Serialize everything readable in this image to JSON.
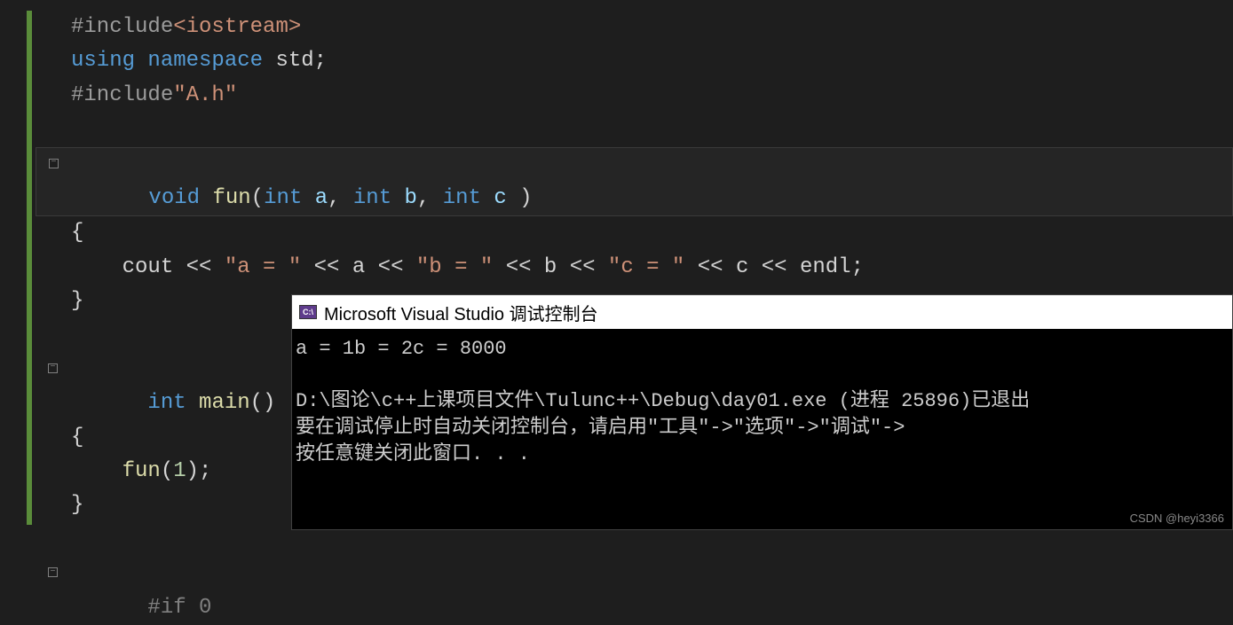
{
  "code": {
    "line1_include": "#include",
    "line1_file": "<iostream>",
    "line2_using": "using",
    "line2_namespace": "namespace",
    "line2_std": "std",
    "line2_semi": ";",
    "line3_include": "#include",
    "line3_file": "\"A.h\"",
    "line5_void": "void",
    "line5_fun": "fun",
    "line5_params_open": "(",
    "line5_int1": "int",
    "line5_a": "a",
    "line5_comma1": ", ",
    "line5_int2": "int",
    "line5_b": "b",
    "line5_comma2": ", ",
    "line5_int3": "int",
    "line5_c": "c",
    "line5_close": " )",
    "line6_brace": "{",
    "line7_cout": "cout",
    "line7_op1": " << ",
    "line7_str1": "\"a = \"",
    "line7_op2": " << ",
    "line7_a": "a",
    "line7_op3": " << ",
    "line7_str2": "\"b = \"",
    "line7_op4": " << ",
    "line7_b": "b",
    "line7_op5": " << ",
    "line7_str3": "\"c = \"",
    "line7_op6": " << ",
    "line7_c": "c",
    "line7_op7": " << ",
    "line7_endl": "endl",
    "line7_semi": ";",
    "line8_brace": "}",
    "line10_int": "int",
    "line10_main": "main",
    "line10_parens": "()",
    "line11_brace": "{",
    "line12_fun": "fun",
    "line12_open": "(",
    "line12_arg": "1",
    "line12_close": ")",
    "line12_semi": ";",
    "line13_brace": "}",
    "line15_if": "#if",
    "line15_zero": "0"
  },
  "console": {
    "title": "Microsoft Visual Studio 调试控制台",
    "icon_text": "C:\\",
    "line1": "a = 1b = 2c = 8000",
    "line2": "",
    "line3": "D:\\图论\\c++上课项目文件\\Tulunc++\\Debug\\day01.exe (进程 25896)已退出",
    "line4": "要在调试停止时自动关闭控制台，请启用\"工具\"->\"选项\"->\"调试\"->",
    "line5": "按任意键关闭此窗口. . ."
  },
  "watermark": "CSDN @heyi3366",
  "fold_minus": "−"
}
